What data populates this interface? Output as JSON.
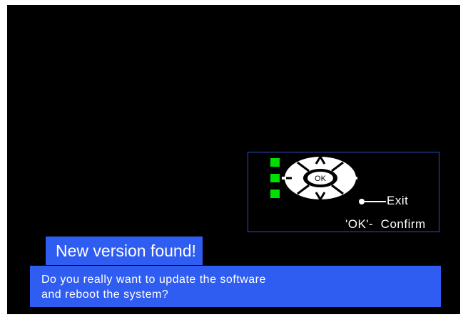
{
  "dialog": {
    "title": "New version found!",
    "message_line1": "Do you really want to update the software",
    "message_line2": "and reboot the system?"
  },
  "help": {
    "ok_key_label": "OK",
    "exit_label": "Exit",
    "confirm_label": "'OK'-  Confirm",
    "icons": [
      "up-arrow-icon",
      "down-arrow-icon",
      "minus-icon",
      "plus-icon",
      "indicator-icon"
    ]
  },
  "colors": {
    "background": "#000000",
    "dialog_blue": "#2f5df2",
    "panel_border": "#2f4dd0",
    "indicator_green": "#00e000"
  }
}
